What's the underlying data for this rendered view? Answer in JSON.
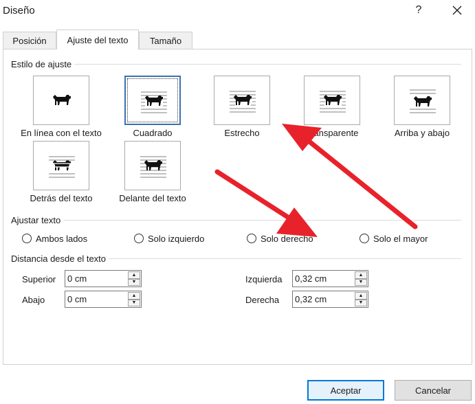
{
  "window": {
    "title": "Diseño",
    "help_label": "?"
  },
  "tabs": [
    {
      "label": "Posición",
      "active": false
    },
    {
      "label": "Ajuste del texto",
      "active": true
    },
    {
      "label": "Tamaño",
      "active": false
    }
  ],
  "wrap_style": {
    "group_label": "Estilo de ajuste",
    "options": [
      {
        "label": "En línea con el texto",
        "selected": false
      },
      {
        "label": "Cuadrado",
        "selected": true
      },
      {
        "label": "Estrecho",
        "selected": false
      },
      {
        "label": "Transparente",
        "selected": false
      },
      {
        "label": "Arriba y abajo",
        "selected": false
      },
      {
        "label": "Detrás del texto",
        "selected": false
      },
      {
        "label": "Delante del texto",
        "selected": false
      }
    ]
  },
  "wrap_text": {
    "group_label": "Ajustar texto",
    "options": [
      {
        "label": "Ambos lados",
        "checked": false
      },
      {
        "label": "Solo izquierdo",
        "checked": false
      },
      {
        "label": "Solo derecho",
        "checked": false
      },
      {
        "label": "Solo el mayor",
        "checked": false
      }
    ]
  },
  "distance": {
    "group_label": "Distancia desde el texto",
    "top": {
      "label": "Superior",
      "value": "0 cm"
    },
    "bottom": {
      "label": "Abajo",
      "value": "0 cm"
    },
    "left": {
      "label": "Izquierda",
      "value": "0,32 cm"
    },
    "right": {
      "label": "Derecha",
      "value": "0,32 cm"
    }
  },
  "buttons": {
    "ok_label": "Aceptar",
    "cancel_label": "Cancelar"
  },
  "colors": {
    "accent": "#0078d7",
    "selection": "#3c6fb4",
    "annotation_arrow": "#e8222a"
  }
}
